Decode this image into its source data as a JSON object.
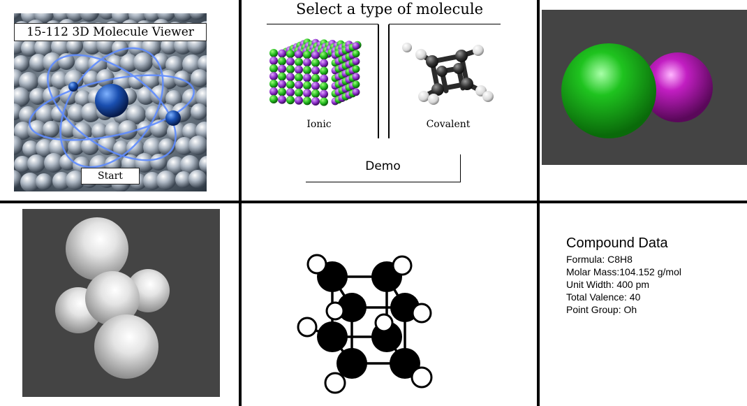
{
  "title_screen": {
    "title": "15-112 3D Molecule Viewer",
    "start_label": "Start"
  },
  "selector": {
    "heading": "Select a type of molecule",
    "options": [
      {
        "label": "Ionic",
        "icon": "ionic-lattice-icon"
      },
      {
        "label": "Covalent",
        "icon": "cubane-icon"
      }
    ],
    "demo_label": "Demo"
  },
  "ionic_render": {
    "background": "#444444",
    "atom_colors": [
      "#1fc31f",
      "#c21ec2"
    ]
  },
  "covalent_render": {
    "background": "#444444",
    "atom_color": "#f0f0f0"
  },
  "compound_data": {
    "heading": "Compound Data",
    "formula": "Formula: C8H8",
    "molar_mass": "Molar Mass:104.152 g/mol",
    "unit_width": "Unit Width: 400 pm",
    "total_valence": "Total Valence: 40",
    "point_group": "Point Group: Oh"
  }
}
